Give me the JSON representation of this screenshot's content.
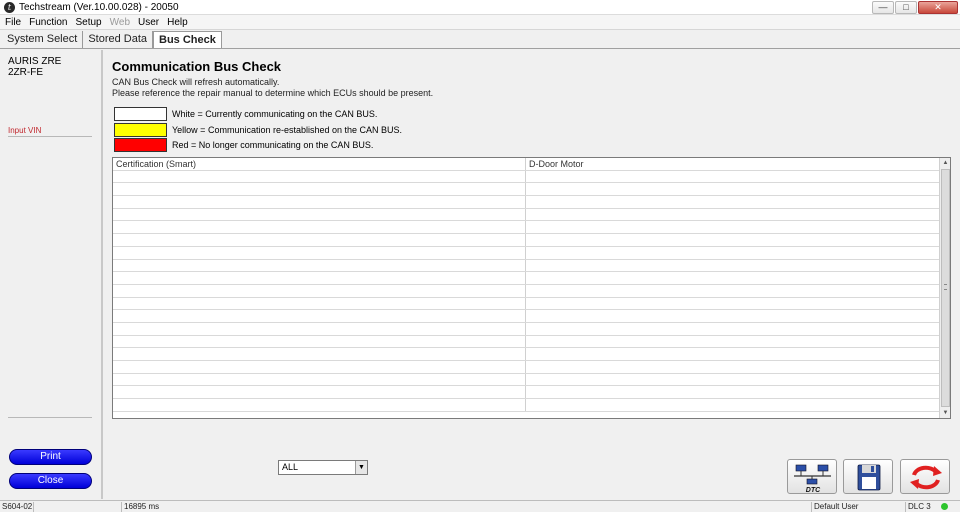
{
  "window": {
    "title": "Techstream (Ver.10.00.028) - 20050",
    "controls": [
      "minimize",
      "maximize",
      "close"
    ]
  },
  "menu": {
    "items": [
      {
        "label": "File",
        "enabled": true
      },
      {
        "label": "Function",
        "enabled": true
      },
      {
        "label": "Setup",
        "enabled": true
      },
      {
        "label": "Web",
        "enabled": false
      },
      {
        "label": "User",
        "enabled": true
      },
      {
        "label": "Help",
        "enabled": true
      }
    ]
  },
  "tabs": [
    {
      "label": "System Select",
      "active": false
    },
    {
      "label": "Stored Data",
      "active": false
    },
    {
      "label": "Bus Check",
      "active": true
    }
  ],
  "sidebar": {
    "vehicle_model": "AURIS ZRE",
    "engine": "2ZR-FE",
    "vin_link": "Input VIN",
    "print_label": "Print",
    "close_label": "Close"
  },
  "main": {
    "title": "Communication Bus Check",
    "info_line1": "CAN Bus Check will refresh automatically.",
    "info_line2": "Please reference the repair manual to determine which ECUs should be present.",
    "legend": [
      {
        "color": "#ffffff",
        "text": "White = Currently communicating on the CAN BUS."
      },
      {
        "color": "#ffff00",
        "text": "Yellow = Communication re-established on the CAN BUS."
      },
      {
        "color": "#ff0000",
        "text": "Red = No longer communicating on the CAN BUS."
      }
    ],
    "table": {
      "rows": [
        [
          "Certification (Smart)",
          "D-Door Motor"
        ],
        [
          "",
          ""
        ],
        [
          "",
          ""
        ],
        [
          "",
          ""
        ],
        [
          "",
          ""
        ],
        [
          "",
          ""
        ],
        [
          "",
          ""
        ],
        [
          "",
          ""
        ],
        [
          "",
          ""
        ],
        [
          "",
          ""
        ],
        [
          "",
          ""
        ],
        [
          "",
          ""
        ],
        [
          "",
          ""
        ],
        [
          "",
          ""
        ],
        [
          "",
          ""
        ],
        [
          "",
          ""
        ],
        [
          "",
          ""
        ],
        [
          "",
          ""
        ],
        [
          "",
          ""
        ],
        [
          "",
          ""
        ]
      ]
    },
    "filter_select": "ALL",
    "tool_buttons": [
      {
        "name": "dtc",
        "label": "DTC",
        "icon": "network-dtc-icon"
      },
      {
        "name": "save",
        "icon": "floppy-disk-icon"
      },
      {
        "name": "refresh",
        "icon": "refresh-arrows-icon"
      }
    ]
  },
  "statusbar": {
    "screen_code": "S604-02",
    "timer": "16895 ms",
    "user": "Default User",
    "connection": "DLC 3",
    "led_color": "#2cc42c"
  }
}
